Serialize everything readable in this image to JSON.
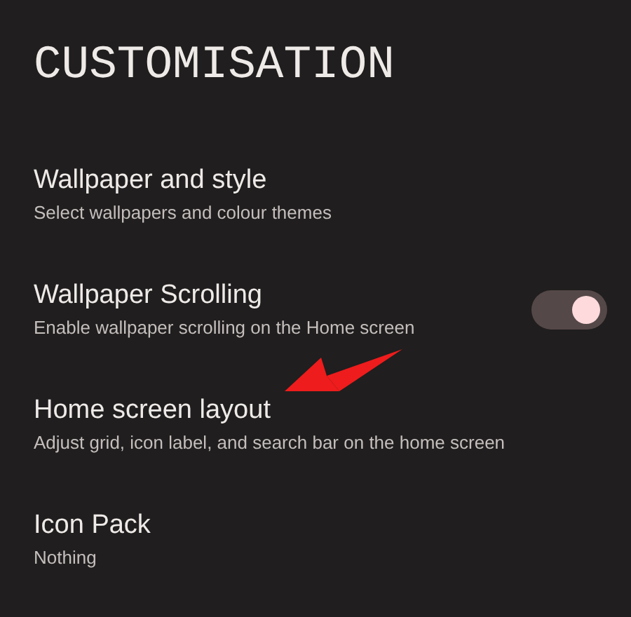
{
  "title": "CUSTOMISATION",
  "items": [
    {
      "kind": "text",
      "title": "Wallpaper and style",
      "subtitle": "Select wallpapers and colour themes"
    },
    {
      "kind": "switch",
      "title": "Wallpaper Scrolling",
      "subtitle": "Enable wallpaper scrolling on the Home screen",
      "on": true
    },
    {
      "kind": "text",
      "title": "Home screen layout",
      "subtitle": "Adjust grid, icon label, and search bar on the home screen"
    },
    {
      "kind": "text",
      "title": "Icon Pack",
      "subtitle": "Nothing"
    }
  ]
}
